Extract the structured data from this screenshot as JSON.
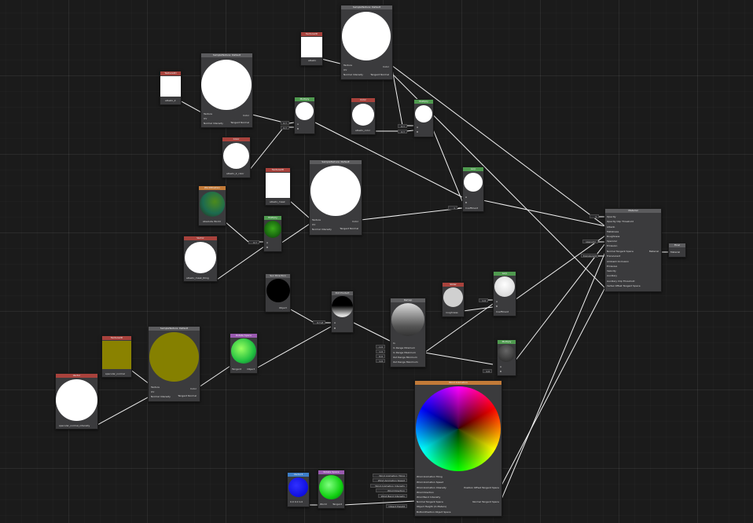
{
  "nodes": {
    "sample_top": {
      "title": "SampleTexture: Default",
      "in": [
        "Texture",
        "UV",
        "Normal Intensity"
      ],
      "out": [
        "Color",
        "Tangent Normal"
      ]
    },
    "sample_left": {
      "title": "SampleTexture: Default",
      "in": [
        "Texture",
        "UV",
        "Normal Intensity"
      ],
      "out": [
        "Color",
        "Tangent Normal"
      ]
    },
    "sample_mid": {
      "title": "SampleTexture: Default",
      "in": [
        "Texture",
        "UV",
        "Normal Intensity"
      ],
      "out": [
        "Color",
        "Tangent Normal"
      ]
    },
    "sample_bottom": {
      "title": "SampleTexture: Default",
      "in": [
        "Texture",
        "UV",
        "Normal Intensity"
      ],
      "out": [
        "Color",
        "Tangent Normal"
      ]
    },
    "tex_albedo": {
      "title": "Texture2D",
      "label": "albedo"
    },
    "tex_albedo2": {
      "title": "Texture2D",
      "label": "albedo_2"
    },
    "tex_mask": {
      "title": "Texture2D",
      "label": "albedo_mask"
    },
    "tex_specular": {
      "title": "Texture2D",
      "label": "specular_normal"
    },
    "color_albedo": {
      "title": "Color",
      "label": "albedo_color"
    },
    "color_albedo2": {
      "title": "Color",
      "label": "albedo_2_color"
    },
    "multiply_1": {
      "title": "Multiply",
      "in": [
        "A",
        "B"
      ]
    },
    "multiply_2": {
      "title": "Multiply",
      "in": [
        "A",
        "B"
      ]
    },
    "multiply_3": {
      "title": "Multiply",
      "in": [
        "A",
        "B"
      ]
    },
    "multiply_4": {
      "title": "Multiply",
      "in": [
        "A",
        "B"
      ]
    },
    "lerp_1": {
      "title": "Lerp",
      "in": [
        "A",
        "B",
        "Coefficient"
      ]
    },
    "lerp_2": {
      "title": "Lerp",
      "in": [
        "A",
        "B",
        "Coefficient"
      ]
    },
    "world_pos": {
      "title": "WorldPosition",
      "label": "Absolute World"
    },
    "vector_tiling": {
      "title": "Vector",
      "label": "albedo_mask_tiling"
    },
    "sun_dir": {
      "title": "Sun Direction",
      "label": "Object"
    },
    "dot_product": {
      "title": "Dot Product",
      "in": [
        "A",
        "B"
      ]
    },
    "remap": {
      "title": "Remap",
      "in": [
        "In",
        "In Range Minimum",
        "In Range Maximum",
        "Out Range Minimum",
        "Out Range Maximum"
      ]
    },
    "slider": {
      "title": "Slider",
      "label": "roughness"
    },
    "rotate_space": {
      "title": "Rotate Space",
      "in": [
        "Tangent"
      ],
      "out": [
        "Object"
      ]
    },
    "rotate_space2": {
      "title": "Rotate Space",
      "in": [
        "World"
      ],
      "out": [
        "Tangent"
      ]
    },
    "vector_spec": {
      "title": "Vector",
      "label": "specular_normal_intensity"
    },
    "vector_blue": {
      "title": "Vector3",
      "label": "0.0 0.0 1.0"
    },
    "wind": {
      "title": "Wind Animation",
      "in": [
        "Wind Animation Tiling",
        "Wind Animation Speed",
        "Wind Animation Intensity",
        "Wind Direction",
        "Wind Bend Intensity",
        "Normal Tangent Space",
        "Object Height (In Meters)",
        "BottomPosition Object Space"
      ],
      "out": [
        "Position Offset Tangent Space",
        "Normal Tangent Space"
      ],
      "fields": [
        "Wind Animation Tiling",
        "Wind Animation Speed",
        "Wind Animation Intensity",
        "Wind Direction",
        "Wind Bend Intensity",
        "Object Height"
      ]
    },
    "material": {
      "title": "Material",
      "in": [
        "Opacity",
        "Opacity Clip Threshold",
        "Albedo",
        "Metalness",
        "Roughness",
        "Specular",
        "Emission",
        "Normal Tangent Space",
        "Translucent",
        "Ambient Occlusion",
        "Emissive",
        "Velocity",
        "Auxiliary",
        "Auxiliary Clip Threshold",
        "Vertex Offset Tangent Space"
      ],
      "out": [
        "Material"
      ],
      "fields": [
        "1",
        "specular",
        "translucent"
      ]
    },
    "final": {
      "title": "Final",
      "in": [
        "Material"
      ]
    }
  },
  "fields": {
    "xy1": "X,Y",
    "xy2": "X,Y",
    "xy3": "X,Y",
    "xy4": "X,Y",
    "xyz": "X,Y,Z",
    "one_a": "1",
    "one_b": "1.0",
    "one_c": "1.0",
    "remap_vals": [
      "-1.0",
      "1.0",
      "0.0",
      "1.0"
    ],
    "xy_tiling": "X,Y"
  },
  "colors": {
    "header_red": "#a8423c",
    "header_green": "#4f9a4f",
    "header_orange": "#c27a38",
    "olive": "#8a8200",
    "wire": "#f2f2f2"
  }
}
